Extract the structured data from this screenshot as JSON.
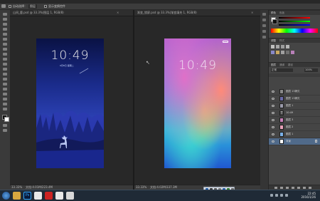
{
  "options_bar": {
    "auto_select_label": "自动选择：",
    "layer_dropdown": "图层",
    "show_transform_label": "显示变换控件"
  },
  "documents": [
    {
      "tab_title": "山间_鹿.psd @ 33.3%(图层 1, RGB/8)",
      "zoom": "33.33%",
      "doc_info": "文档:4.01M/223.4M",
      "time": "10:49",
      "date": "9月8日  星期二"
    },
    {
      "tab_title": "渐变_锁屏.psd @ 33.3%(渐变填充 1, RGB/8)",
      "zoom": "33.33%",
      "doc_info": "文档:4.02M/337.3M",
      "time": "10:49"
    }
  ],
  "panels": {
    "color_tab": "颜色",
    "swatches_tab": "色板",
    "adjust_tab": "调整",
    "styles_tab": "样式",
    "layers_tab": "图层",
    "channels_tab": "通道",
    "paths_tab": "路径",
    "blend_mode": "正常",
    "opacity": "100%",
    "layers": [
      {
        "name": "图层 13拷贝",
        "thumb": "#8a8a8a"
      },
      {
        "name": "图层 13拷贝",
        "thumb": "#6a6aa8"
      },
      {
        "name": "图层 1",
        "thumb": "#9a9aaa"
      },
      {
        "name": "10:49",
        "thumb": "#4a4a4a"
      },
      {
        "name": "图层 3",
        "thumb": "#c880b8"
      },
      {
        "name": "图层 2",
        "thumb": "#e8a0b8"
      },
      {
        "name": "图层 1",
        "thumb": "#7ab0e8"
      },
      {
        "name": "背景",
        "thumb": "#ffffff"
      }
    ]
  },
  "taskbar": {
    "time": "22:45",
    "date": "2016/1/26"
  },
  "colors": {
    "canvas_bg": "#282828",
    "app_bg": "#535353",
    "taskbar": "#1f2a36"
  }
}
